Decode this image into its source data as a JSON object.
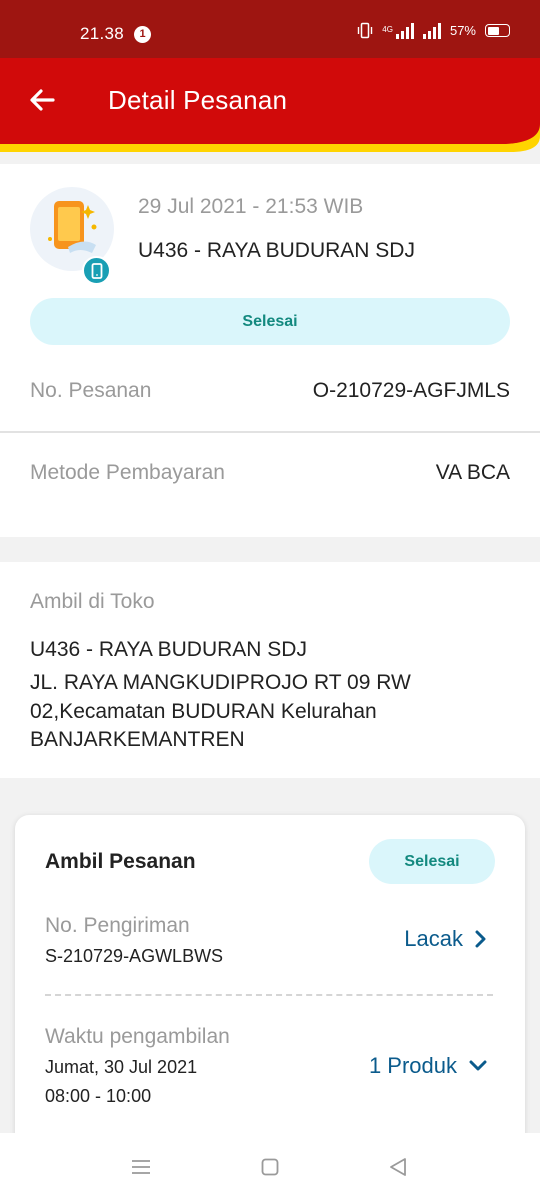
{
  "status_bar": {
    "time": "21.38",
    "notification_count": "1",
    "network": "4G",
    "battery": "57%",
    "battery_level": 0.57
  },
  "header": {
    "title": "Detail Pesanan",
    "back_icon": "arrow-left-icon"
  },
  "colors": {
    "header_red": "#d10a0a",
    "status_bar": "#9e1511",
    "accent_yellow": "#ffd400",
    "status_pill_bg": "#daf6fb",
    "status_pill_text": "#13897f",
    "link_blue": "#0b5b8c"
  },
  "order": {
    "date": "29 Jul 2021 - 21:53 WIB",
    "store": "U436 - RAYA BUDURAN SDJ",
    "status": "Selesai",
    "order_number_label": "No. Pesanan",
    "order_number": "O-210729-AGFJMLS",
    "payment_label": "Metode Pembayaran",
    "payment_value": "VA BCA"
  },
  "pickup": {
    "label": "Ambil di Toko",
    "store": "U436 - RAYA BUDURAN SDJ",
    "address": "JL. RAYA MANGKUDIPROJO RT 09 RW 02,Kecamatan BUDURAN Kelurahan BANJARKEMANTREN"
  },
  "shipment": {
    "title": "Ambil Pesanan",
    "status": "Selesai",
    "shipping_label": "No. Pengiriman",
    "shipping_number": "S-210729-AGWLBWS",
    "track_label": "Lacak",
    "pickup_time_label": "Waktu pengambilan",
    "pickup_date": "Jumat, 30 Jul 2021",
    "pickup_time": "08:00 - 10:00",
    "products_label": "1 Produk"
  },
  "nav": {
    "icons": [
      "menu-icon",
      "home-square-icon",
      "back-triangle-icon"
    ]
  }
}
